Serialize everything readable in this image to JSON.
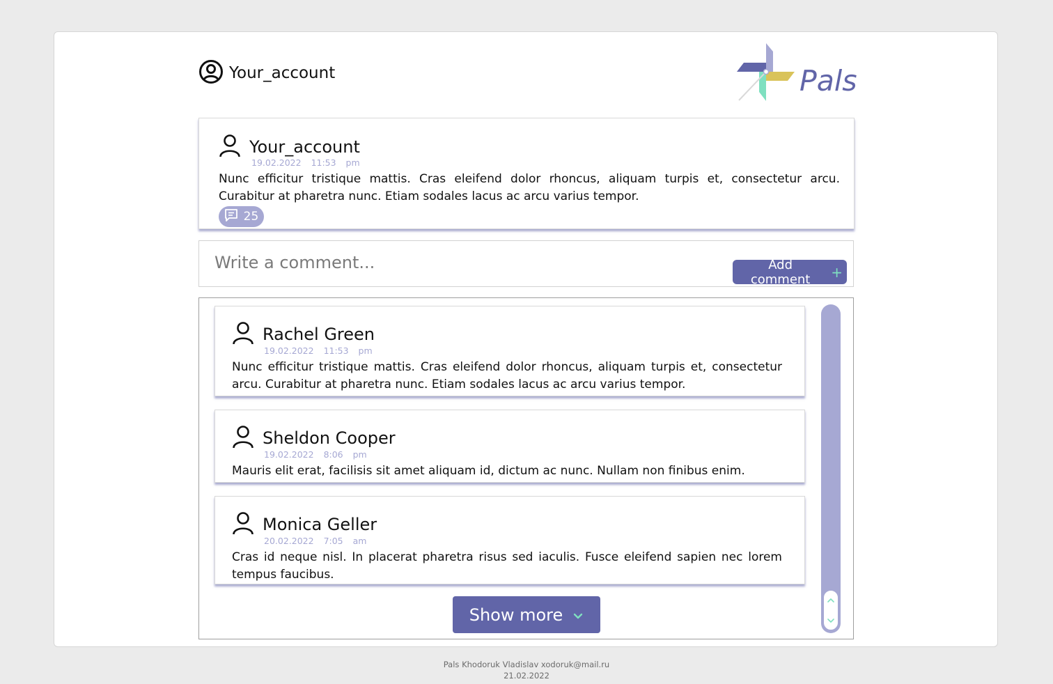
{
  "header": {
    "account_title": "Your_account",
    "logo_text": "Pals"
  },
  "post": {
    "author": "Your_account",
    "date": "19.02.2022",
    "time": "11:53 pm",
    "text": "Nunc efficitur tristique mattis. Cras eleifend dolor rhoncus, aliquam turpis et, consectetur arcu. Curabitur at pharetra nunc. Etiam sodales lacus ac arcu varius tempor.",
    "comment_count": "25"
  },
  "composer": {
    "placeholder": "Write a comment...",
    "value": "",
    "add_label": "Add comment",
    "add_icon": "+"
  },
  "comments": [
    {
      "author": "Rachel Green",
      "date": "19.02.2022",
      "time": "11:53 pm",
      "text": "Nunc efficitur tristique mattis. Cras eleifend dolor rhoncus, aliquam turpis et, consectetur arcu. Curabitur at pharetra nunc. Etiam sodales lacus ac arcu varius tempor."
    },
    {
      "author": "Sheldon Cooper",
      "date": "19.02.2022",
      "time": "8:06 pm",
      "text": "Mauris elit erat, facilisis sit amet aliquam id, dictum ac nunc. Nullam non finibus enim."
    },
    {
      "author": "Monica Geller",
      "date": "20.02.2022",
      "time": "7:05 am",
      "text": "Cras id neque nisl. In placerat pharetra risus sed iaculis. Fusce eleifend sapien nec lorem tempus faucibus."
    }
  ],
  "show_more_label": "Show more",
  "footer": {
    "line1": "Pals Khodoruk Vladislav xodoruk@mail.ru",
    "line2": "21.02.2022"
  },
  "colors": {
    "accent": "#6165a8",
    "accent_light": "#a6a8d3",
    "mint": "#7fe0c0",
    "gold": "#d9c35a"
  }
}
